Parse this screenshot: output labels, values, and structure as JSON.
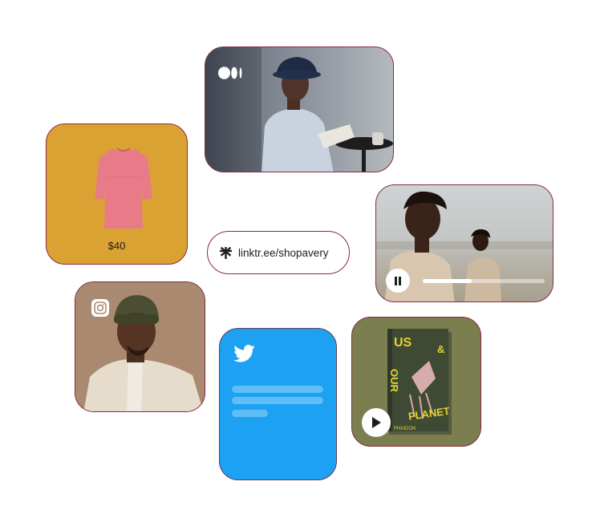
{
  "cards": {
    "medium": {
      "icon": "medium-logo-icon"
    },
    "product": {
      "price": "$40",
      "image": "pink-shirt"
    },
    "link": {
      "url": "linktr.ee/shopavery",
      "icon": "linktree-asterisk-icon"
    },
    "video": {
      "progress": 0.4,
      "control": "pause-icon"
    },
    "instagram": {
      "icon": "instagram-icon"
    },
    "twitter": {
      "icon": "twitter-bird-icon"
    },
    "book": {
      "title_lines": [
        "US",
        "&",
        "OUR",
        "PLANET"
      ],
      "publisher": "PHAIDON",
      "control": "play-icon"
    }
  },
  "colors": {
    "border": "#8a2b3c",
    "product_bg": "#d9a233",
    "twitter_bg": "#1da1f2",
    "book_card_bg": "#7b7e4f"
  }
}
